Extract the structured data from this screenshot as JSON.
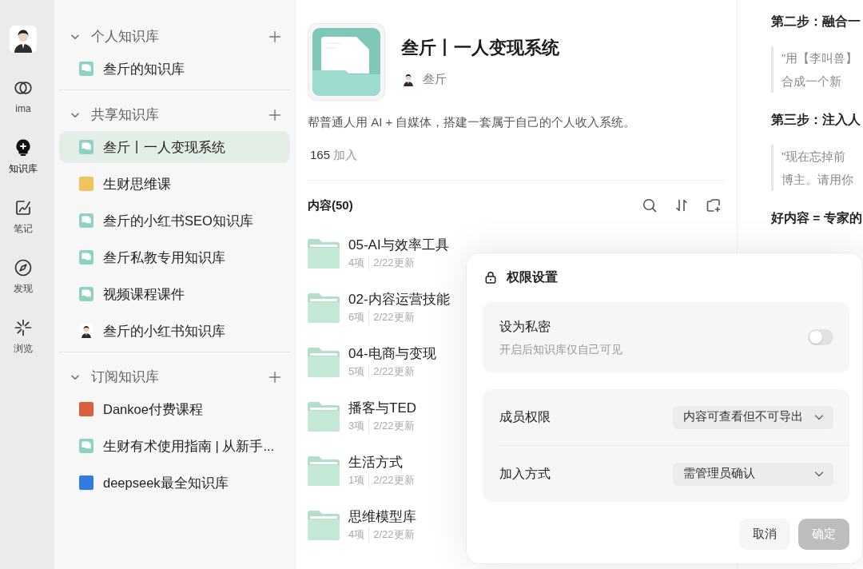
{
  "rail": {
    "items": [
      {
        "label": "ima",
        "selected": false
      },
      {
        "label": "知识库",
        "selected": true
      },
      {
        "label": "笔记",
        "selected": false
      },
      {
        "label": "发现",
        "selected": false
      },
      {
        "label": "浏览",
        "selected": false
      }
    ]
  },
  "sidebar": {
    "sections": [
      {
        "title": "个人知识库",
        "expanded": true,
        "items": [
          {
            "label": "叁斤的知识库",
            "kind": "library",
            "selected": false
          }
        ]
      },
      {
        "title": "共享知识库",
        "expanded": true,
        "items": [
          {
            "label": "叁斤丨一人变现系统",
            "kind": "library",
            "selected": true
          },
          {
            "label": "生财思维课",
            "kind": "cover",
            "color": "#f1c35e",
            "selected": false
          },
          {
            "label": "叁斤的小红书SEO知识库",
            "kind": "library",
            "selected": false
          },
          {
            "label": "叁斤私教专用知识库",
            "kind": "library",
            "selected": false
          },
          {
            "label": "视频课程课件",
            "kind": "library",
            "selected": false
          },
          {
            "label": "叁斤的小红书知识库",
            "kind": "avatar",
            "selected": false
          }
        ]
      },
      {
        "title": "订阅知识库",
        "expanded": true,
        "items": [
          {
            "label": "Dankoe付费课程",
            "kind": "cover",
            "color": "#d8603a",
            "selected": false
          },
          {
            "label": "生财有术使用指南 | 从新手...",
            "kind": "library",
            "selected": false
          },
          {
            "label": "deepseek最全知识库",
            "kind": "cover",
            "color": "#2f7de1",
            "selected": false
          }
        ]
      }
    ]
  },
  "library": {
    "title": "叁斤丨一人变现系统",
    "author": "叁斤",
    "description": "帮普通人用 AI + 自媒体，搭建一套属于自己的个人收入系统。",
    "members": {
      "count": "165",
      "label": "加入"
    },
    "content_title": "内容(50)",
    "folders": [
      {
        "name": "05-AI与效率工具",
        "count": "4项",
        "updated": "2/22更新"
      },
      {
        "name": "02-内容运营技能",
        "count": "6项",
        "updated": "2/22更新"
      },
      {
        "name": "04-电商与变现",
        "count": "5项",
        "updated": "2/22更新"
      },
      {
        "name": "播客与TED",
        "count": "3项",
        "updated": "2/22更新"
      },
      {
        "name": "生活方式",
        "count": "1项",
        "updated": "2/22更新"
      },
      {
        "name": "思维模型库",
        "count": "4项",
        "updated": "2/22更新"
      }
    ]
  },
  "document": {
    "blocks": [
      {
        "kind": "heading",
        "text": "第二步：融合一"
      },
      {
        "kind": "quote",
        "lines": [
          "\"用【李叫兽】",
          "合成一个新"
        ]
      },
      {
        "kind": "heading",
        "text": "第三步：注入人"
      },
      {
        "kind": "quote",
        "lines": [
          "\"现在忘掉前",
          "博主。请用你"
        ]
      },
      {
        "kind": "heading",
        "text": "好内容 = 专家的"
      }
    ]
  },
  "permissions_dialog": {
    "title": "权限设置",
    "private": {
      "label": "设为私密",
      "hint": "开启后知识库仅自己可见",
      "on": false
    },
    "settings": [
      {
        "label": "成员权限",
        "value": "内容可查看但不可导出"
      },
      {
        "label": "加入方式",
        "value": "需管理员确认"
      }
    ],
    "buttons": [
      {
        "label": "取消",
        "kind": "secondary",
        "disabled": false
      },
      {
        "label": "确定",
        "kind": "primary",
        "disabled": true
      }
    ]
  }
}
